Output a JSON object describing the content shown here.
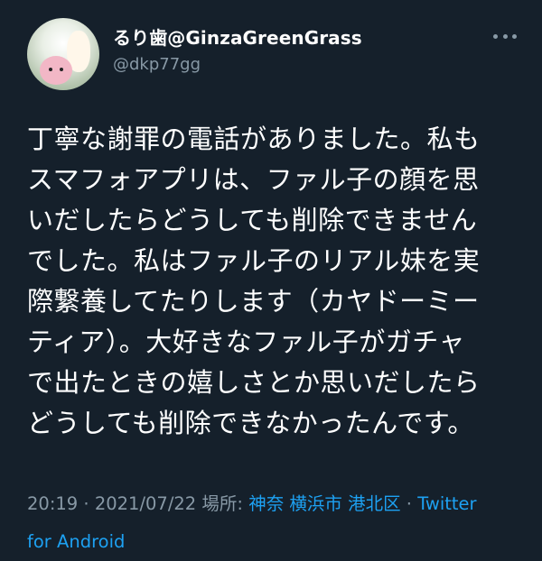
{
  "user": {
    "display_name": "るり歯@GinzaGreenGrass",
    "handle": "@dkp77gg"
  },
  "tweet": {
    "lines": [
      "丁寧な謝罪の電話がありました。私も",
      "スマフォアプリは、ファル子の顔を思",
      "いだしたらどうしても削除できません",
      "でした。私はファル子のリアル妹を実",
      "際繋養してたりします（カヤドーミー",
      "ティア）。大好きなファル子がガチャ",
      "で出たときの嬉しさとか思いだしたら",
      "どうしても削除できなかったんです。"
    ]
  },
  "meta": {
    "time": "20:19",
    "sep1": " · ",
    "date": "2021/07/22",
    "location_label": " 場所: ",
    "location": "神奈 横浜市 港北区",
    "sep2": " · ",
    "source_line1": "Twitter",
    "source_line2": "for Android"
  },
  "colors": {
    "background": "#15202b",
    "secondary_text": "#8899a6",
    "link": "#1da1f2"
  }
}
